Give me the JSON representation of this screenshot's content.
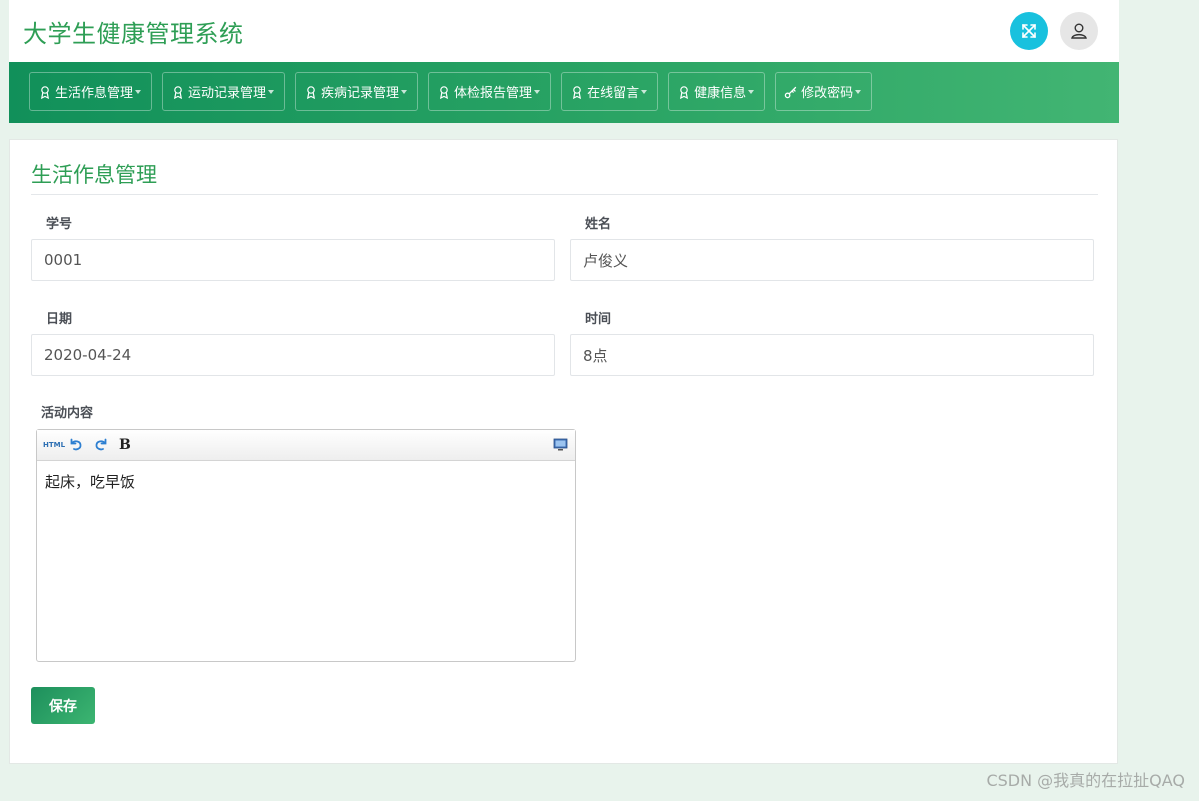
{
  "header": {
    "title": "大学生健康管理系统",
    "fullscreen_icon": "expand-arrows-icon",
    "user_icon": "user-icon",
    "accent_color": "#18c1de"
  },
  "nav": {
    "items": [
      {
        "label": "生活作息管理",
        "icon": "medal-icon"
      },
      {
        "label": "运动记录管理",
        "icon": "medal-icon"
      },
      {
        "label": "疾病记录管理",
        "icon": "medal-icon"
      },
      {
        "label": "体检报告管理",
        "icon": "medal-icon"
      },
      {
        "label": "在线留言",
        "icon": "medal-icon"
      },
      {
        "label": "健康信息",
        "icon": "medal-icon"
      },
      {
        "label": "修改密码",
        "icon": "key-icon"
      }
    ]
  },
  "form": {
    "title": "生活作息管理",
    "student_id": {
      "label": "学号",
      "value": "0001"
    },
    "name": {
      "label": "姓名",
      "value": "卢俊义"
    },
    "date": {
      "label": "日期",
      "value": "2020-04-24"
    },
    "time": {
      "label": "时间",
      "value": "8点"
    },
    "activity": {
      "label": "活动内容",
      "content": "起床，吃早饭",
      "toolbar": {
        "html_label": "HTML",
        "bold_label": "B"
      }
    },
    "save_label": "保存"
  },
  "watermark": "CSDN @我真的在拉扯QAQ",
  "theme": {
    "primary_green": "#2e9e55",
    "nav_gradient_start": "#11905a",
    "nav_gradient_end": "#42b573"
  }
}
